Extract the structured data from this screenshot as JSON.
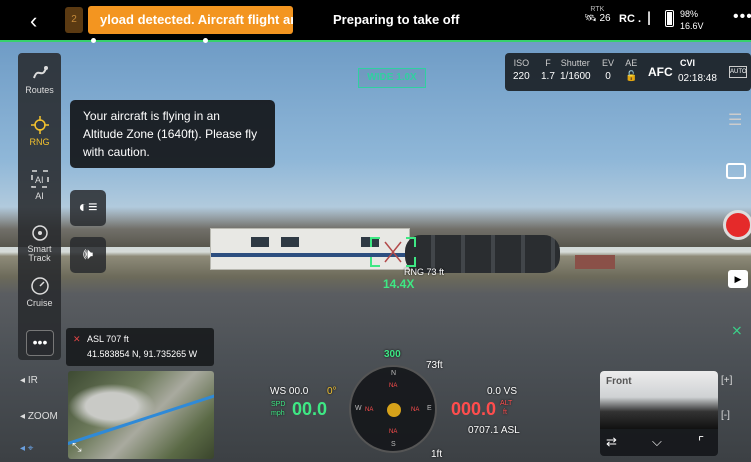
{
  "top": {
    "warning_count": "2",
    "warning_text": "yload detected. Aircraft flight and v",
    "status": "Preparing to take off",
    "gps_label": "RTK",
    "gps_count": "26",
    "rc_label": "RC",
    "battery_percent": "98%",
    "battery_voltage": "16.6V"
  },
  "left_tools": [
    {
      "label": "Routes"
    },
    {
      "label": "RNG",
      "icon_text": "RNG"
    },
    {
      "label": "AI",
      "icon_text": "AI"
    },
    {
      "label": "Smart\nTrack"
    },
    {
      "label": "Cruise"
    }
  ],
  "toast": "Your aircraft is flying in an Altitude Zone (1640ft). Please fly with caution.",
  "wide_label": "WIDE 1.0X",
  "camera": {
    "iso_label": "ISO",
    "iso": "220",
    "f_label": "F",
    "f": "1.7",
    "shutter_label": "Shutter",
    "shutter": "1/1600",
    "ev_label": "EV",
    "ev": "0",
    "ae_label": "AE",
    "afc": "AFC",
    "mode": "CVI",
    "rec_time": "02:18:48",
    "auto": "AUTO"
  },
  "target": {
    "zoom": "14.4X",
    "range": "RNG 73 ft"
  },
  "location": {
    "asl": "ASL 707 ft",
    "coords": "41.583854 N, 91.735265 W"
  },
  "left_labels": {
    "ir": "IR",
    "zoom": "ZOOM"
  },
  "flight": {
    "ws": "WS 00.0",
    "wind_dir": "0°",
    "spd_label": "SPD",
    "spd_unit": "mph",
    "spd": "00.0",
    "heading": "300",
    "alt_top": "73ft",
    "alt_bottom": "1ft",
    "vs": "0.0 VS",
    "alt": "000.0",
    "alt_label": "ALT",
    "alt_unit": "ft",
    "asl": "0707.1 ASL",
    "compass_labels": [
      "N",
      "E",
      "S",
      "W"
    ]
  },
  "fpv": {
    "label": "Front"
  },
  "zoom_controls": {
    "plus": "[+]",
    "minus": "[-]"
  }
}
